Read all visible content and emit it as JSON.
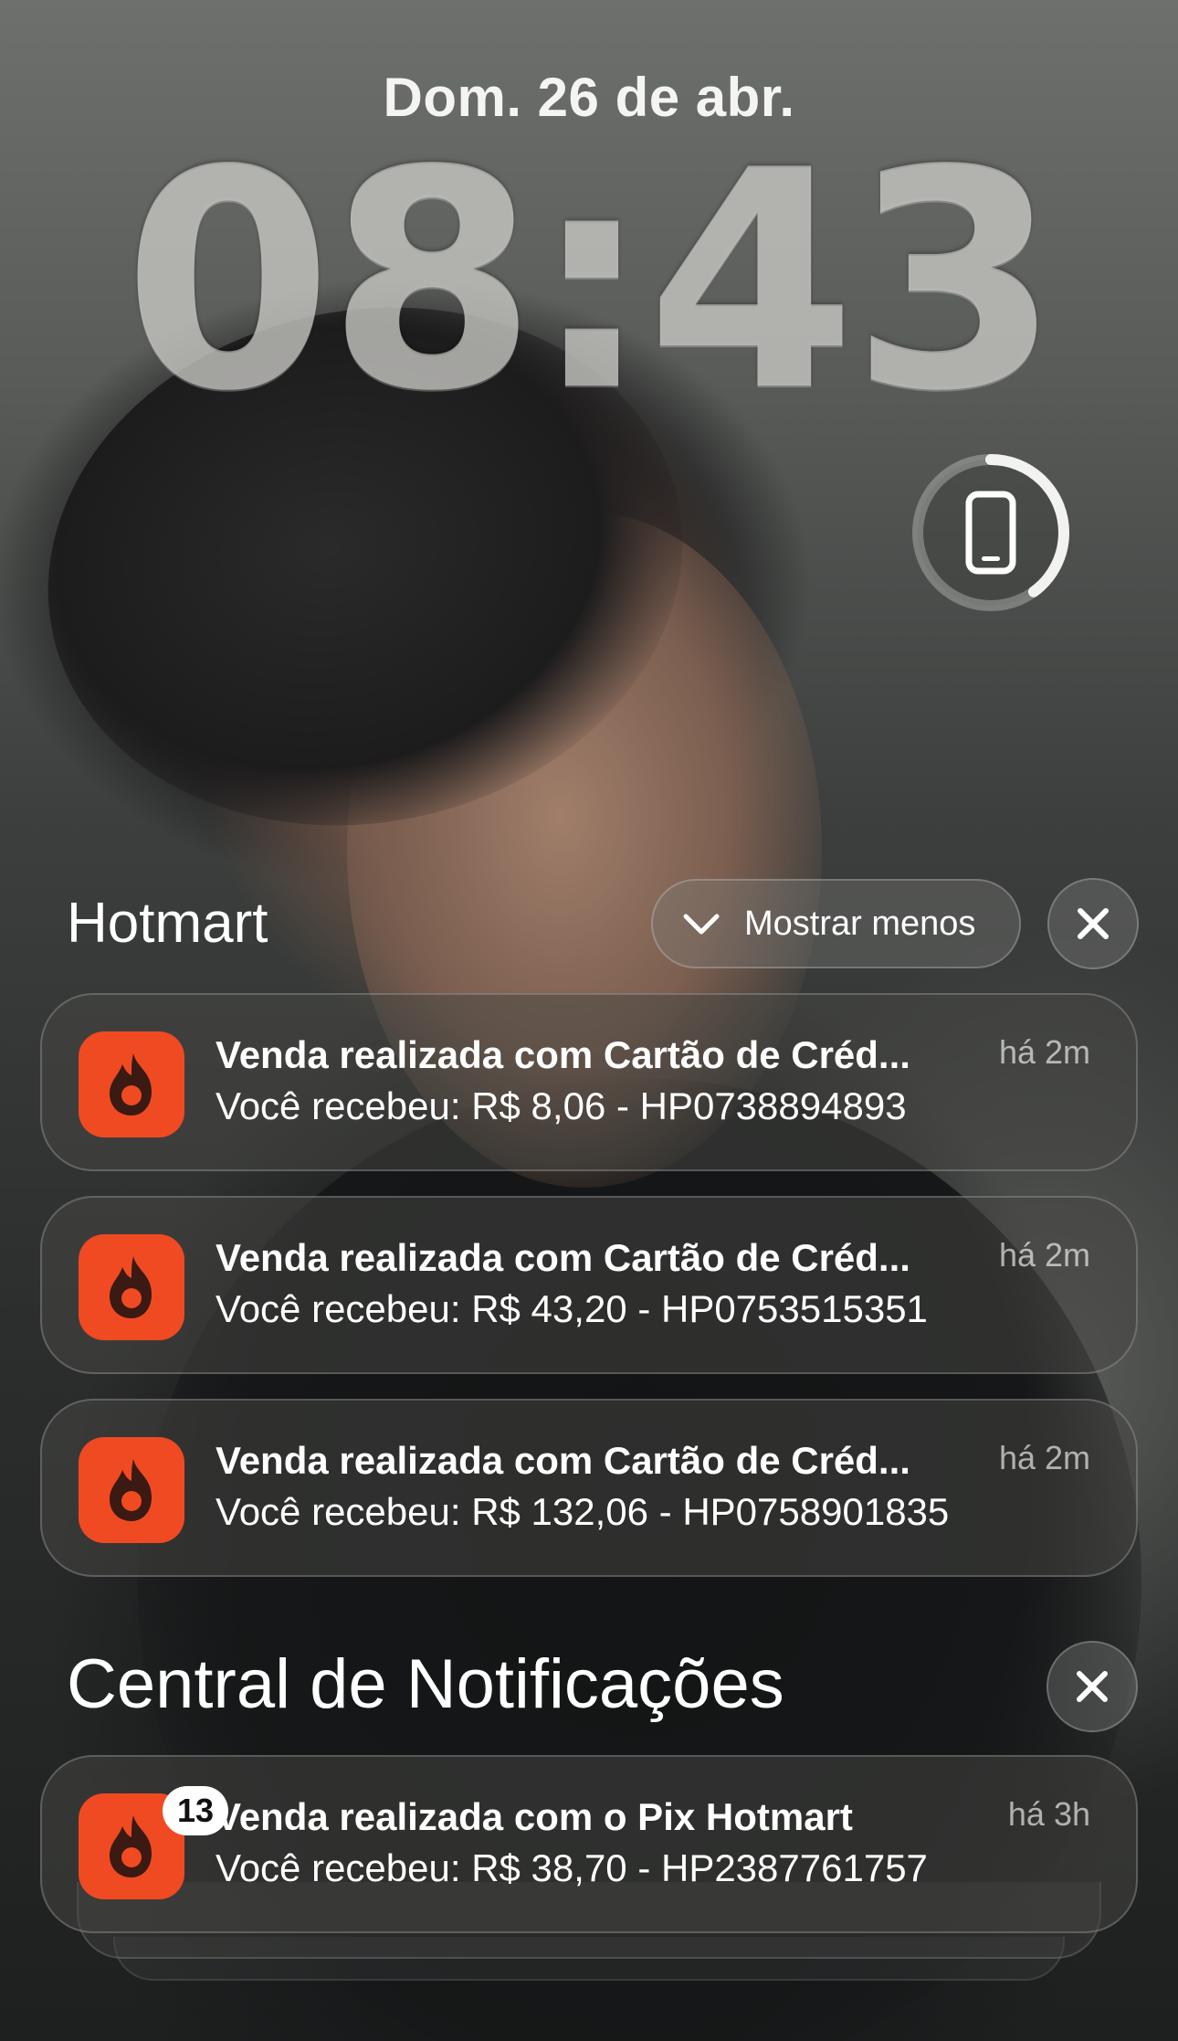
{
  "lock_screen": {
    "date": "Dom. 26 de abr.",
    "time": "08:43",
    "battery_widget": {
      "icon": "phone-icon",
      "charge_fraction": 0.4
    }
  },
  "hotmart_group": {
    "title": "Hotmart",
    "show_less_label": "Mostrar menos",
    "notifications": [
      {
        "title": "Venda realizada com Cartão de Créd...",
        "body": "Você recebeu: R$ 8,06 - HP0738894893",
        "time": "há 2m"
      },
      {
        "title": "Venda realizada com Cartão de Créd...",
        "body": "Você recebeu: R$ 43,20 - HP0753515351",
        "time": "há 2m"
      },
      {
        "title": "Venda realizada com Cartão de Créd...",
        "body": "Você recebeu: R$ 132,06 - HP0758901835",
        "time": "há 2m"
      }
    ]
  },
  "notification_center": {
    "title": "Central de Notificações",
    "stacked": {
      "badge": "13",
      "title": "Venda realizada com o Pix Hotmart",
      "body": "Você recebeu: R$ 38,70 - HP2387761757",
      "time": "há 3h"
    }
  },
  "colors": {
    "hotmart_orange": "#f04a22"
  }
}
